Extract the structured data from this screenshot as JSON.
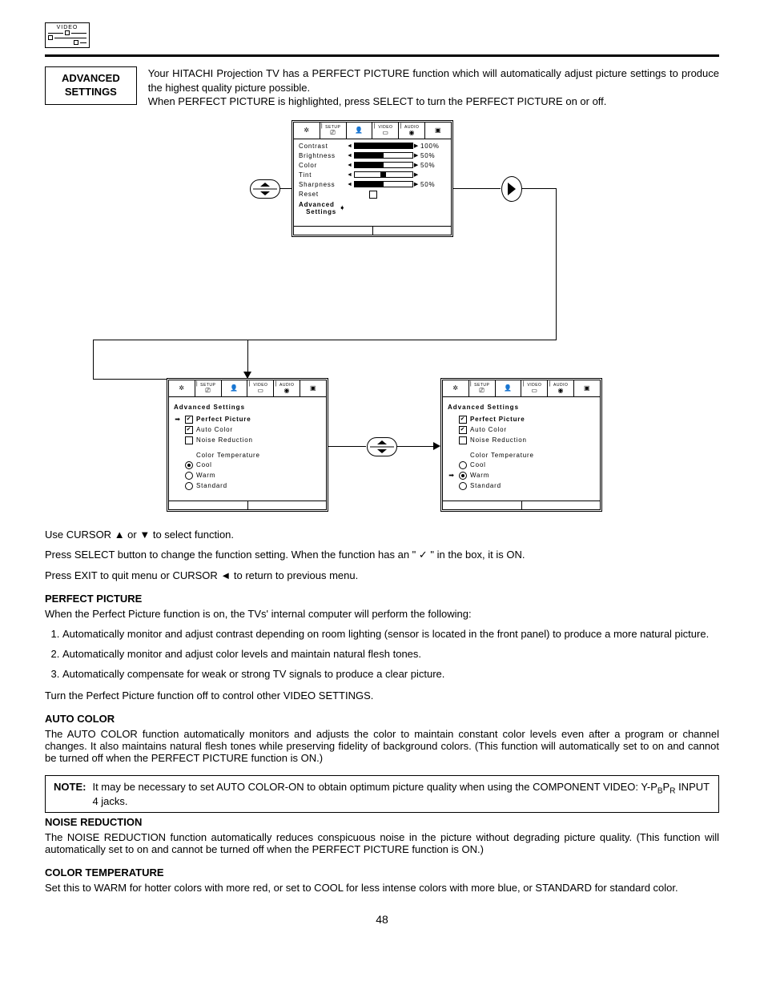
{
  "chip": {
    "label": "VIDEO"
  },
  "header_box": "ADVANCED\nSETTINGS",
  "intro": {
    "p1": "Your HITACHI Projection TV has a PERFECT PICTURE function which will automatically adjust picture settings to produce the highest quality picture possible.",
    "p2": "When PERFECT PICTURE is highlighted, press SELECT to turn the PERFECT PICTURE on or off."
  },
  "tabs": [
    "SETUP",
    "",
    "VIDEO",
    "AUDIO",
    "",
    ""
  ],
  "osd_video": {
    "rows": [
      {
        "label": "Contrast",
        "value": "100%",
        "fill": 100
      },
      {
        "label": "Brightness",
        "value": "50%",
        "fill": 50
      },
      {
        "label": "Color",
        "value": "50%",
        "fill": 50
      },
      {
        "label": "Tint",
        "value": "",
        "fill": 0,
        "tint": true
      },
      {
        "label": "Sharpness",
        "value": "50%",
        "fill": 50
      }
    ],
    "reset": "Reset",
    "advanced": "Advanced\nSettings"
  },
  "osd_adv": {
    "title": "Advanced Settings",
    "perfect": "Perfect Picture",
    "auto": "Auto Color",
    "noise": "Noise Reduction",
    "ct_label": "Color Temperature",
    "cool": "Cool",
    "warm": "Warm",
    "standard": "Standard"
  },
  "instructions": {
    "l1a": "Use CURSOR ",
    "l1b": " or ",
    "l1c": " to select function.",
    "l2a": "Press SELECT button to change the function setting. When the function has an \" ",
    "l2b": " \" in the box, it is ON.",
    "l3a": "Press EXIT to quit menu or CURSOR ",
    "l3b": " to return to previous menu."
  },
  "perfect": {
    "head": "PERFECT PICTURE",
    "intro": "When the Perfect Picture function is on, the TVs' internal computer will perform the following:",
    "items": [
      "Automatically monitor and adjust contrast depending on room lighting (sensor is located in the front panel) to produce a more natural picture.",
      "Automatically monitor and adjust color levels and maintain natural flesh tones.",
      "Automatically compensate for weak or strong TV signals to produce a clear picture."
    ],
    "outro": "Turn the Perfect Picture function off to control other VIDEO SETTINGS."
  },
  "auto": {
    "head": "AUTO COLOR",
    "body": "The AUTO COLOR function automatically monitors and adjusts the color to maintain constant color levels even after a program or channel changes. It also maintains natural flesh tones while preserving fidelity of background colors. (This function will automatically set to on and cannot be turned off when the PERFECT PICTURE function is ON.)"
  },
  "note": {
    "label": "NOTE:",
    "text": "It may be necessary to set AUTO COLOR-ON to obtain optimum picture quality when using the COMPONENT VIDEO: Y-P",
    "sub1": "B",
    "mid": "P",
    "sub2": "R",
    "tail": " INPUT 4 jacks."
  },
  "noise": {
    "head": "NOISE REDUCTION",
    "body": "The NOISE REDUCTION function automatically reduces conspicuous noise in the picture without degrading picture quality. (This function will automatically set to on and cannot be turned off when the PERFECT PICTURE function is ON.)"
  },
  "ct": {
    "head": "COLOR TEMPERATURE",
    "body": "Set this to WARM for hotter colors with more red, or set to COOL for less intense colors with more blue, or STANDARD for standard color."
  },
  "page": "48"
}
